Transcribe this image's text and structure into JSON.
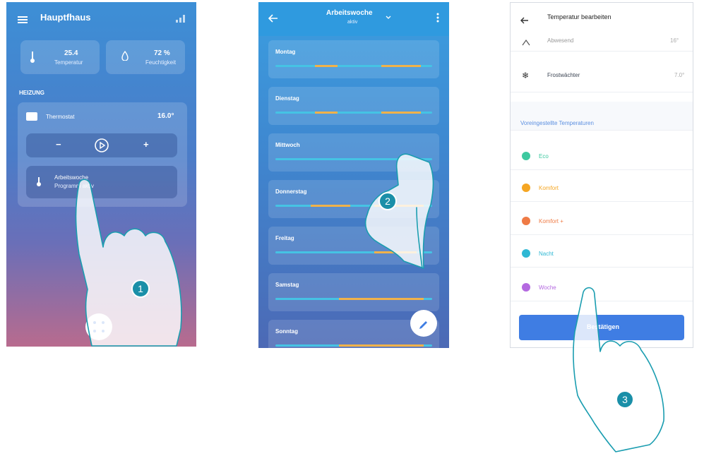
{
  "screen1": {
    "title": "Hauptfhaus",
    "temp_value": "25.4",
    "temp_caption": "Temperatur",
    "humidity_value": "72 %",
    "humidity_caption": "Feuchtigkeit",
    "section_label": "HEIZUNG",
    "thermostat_name": "Thermostat",
    "thermostat_temp": "16.0°",
    "minus": "−",
    "plus": "+",
    "program_name": "Arbeitswoche",
    "program_sub": "Programm aktiv"
  },
  "screen2": {
    "title": "Arbeitswoche",
    "subtitle": "aktiv",
    "days": [
      "Montag",
      "Dienstag",
      "Mittwoch",
      "Donnerstag",
      "Freitag",
      "Samstag",
      "Sonntag"
    ]
  },
  "screen3": {
    "title": "Temperatur bearbeiten",
    "top_item": "Abwesend",
    "top_item_value": "16°",
    "frost_label": "Frostwächter",
    "frost_value": "7.0°",
    "section_title": "Voreingestellte Temperaturen",
    "presets": [
      {
        "label": "Eco",
        "color": "#3ec9a0"
      },
      {
        "label": "Komfort",
        "color": "#f5a623"
      },
      {
        "label": "Komfort +",
        "color": "#ef7b45"
      },
      {
        "label": "Nacht",
        "color": "#2fb8d4"
      },
      {
        "label": "Woche",
        "color": "#b469e0"
      }
    ],
    "confirm_label": "Bestätigen"
  },
  "steps": [
    "1",
    "2",
    "3"
  ],
  "colors": {
    "accent": "#1a8fa8",
    "button": "#3f7de3"
  }
}
